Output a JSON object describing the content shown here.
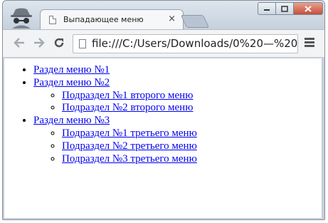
{
  "browser": {
    "tab_title": "Выпадающее меню",
    "tab_close": "×",
    "address": "file:///C:/Users/Downloads/0%20—%20%"
  },
  "page": {
    "menu": [
      {
        "label": "Раздел меню №1",
        "items": []
      },
      {
        "label": "Раздел меню №2",
        "items": [
          "Подраздел №1 второго меню",
          "Подраздел №2 второго меню"
        ]
      },
      {
        "label": "Раздел меню №3",
        "items": [
          "Подраздел №1 третьего меню",
          "Подраздел №2 третьего меню",
          "Подраздел №3 третьего меню"
        ]
      }
    ]
  }
}
